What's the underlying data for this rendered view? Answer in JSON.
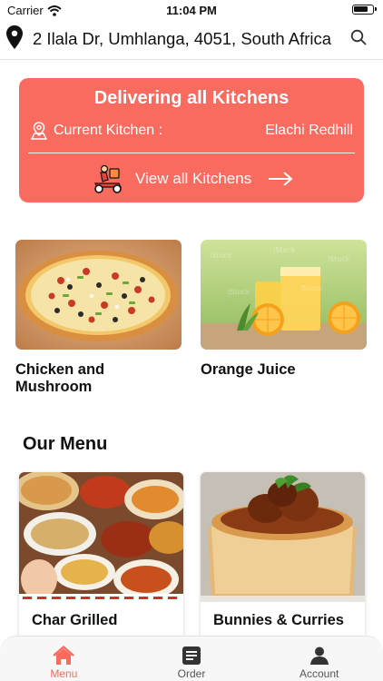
{
  "status_bar": {
    "carrier": "Carrier",
    "time": "11:04 PM"
  },
  "header": {
    "address": "2 Ilala Dr, Umhlanga, 4051, South Africa"
  },
  "banner": {
    "title": "Delivering all Kitchens",
    "current_label": "Current Kitchen :",
    "current_value": "Elachi Redhill",
    "view_all_label": "View all Kitchens"
  },
  "featured": [
    {
      "title": "Chicken and Mushroom"
    },
    {
      "title": "Orange Juice"
    }
  ],
  "menu_section": {
    "title": "Our Menu"
  },
  "menu_items": [
    {
      "title": "Char Grilled"
    },
    {
      "title": "Bunnies & Curries"
    }
  ],
  "tabs": [
    {
      "label": "Menu",
      "icon": "home-icon",
      "active": true
    },
    {
      "label": "Order",
      "icon": "order-icon",
      "active": false
    },
    {
      "label": "Account",
      "icon": "account-icon",
      "active": false
    }
  ],
  "colors": {
    "accent": "#f86b5e"
  }
}
